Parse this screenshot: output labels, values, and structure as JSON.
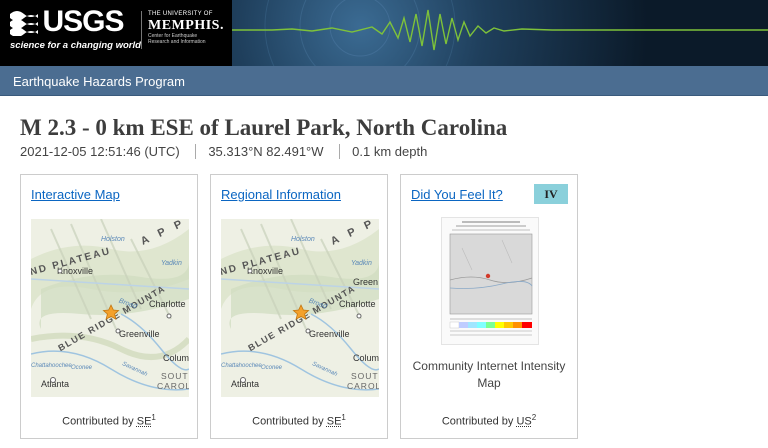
{
  "header": {
    "agency": "USGS",
    "tagline": "science for a changing world",
    "partner_small": "THE UNIVERSITY OF",
    "partner_name": "MEMPHIS.",
    "partner_sub": "Center for Earthquake Research and Information"
  },
  "program": {
    "label": "Earthquake Hazards Program"
  },
  "event": {
    "title": "M 2.3 - 0 km ESE of Laurel Park, North Carolina",
    "time": "2021-12-05 12:51:46 (UTC)",
    "location": "35.313°N 82.491°W",
    "depth": "0.1 km depth"
  },
  "cards": [
    {
      "link": "Interactive Map",
      "contributed_prefix": "Contributed by",
      "source": "SE",
      "ref": "1",
      "map_labels": {
        "plateau": "ND PLATEAU",
        "appa": "A P P",
        "blue_ridge": "BLUE RIDGE MOUNTA",
        "knoxville": "Knoxville",
        "charlotte": "Charlotte",
        "greenville": "Greenville",
        "atlanta": "Atlanta",
        "colum": "Colum",
        "south": "SOUT",
        "caroli": "CAROLI",
        "broad": "Broad",
        "holston": "Holston",
        "yadkin": "Yadkin",
        "chattahoochee": "Chattahoochee",
        "oconee": "Oconee",
        "savannah": "Savannah"
      }
    },
    {
      "link": "Regional Information",
      "contributed_prefix": "Contributed by",
      "source": "SE",
      "ref": "1",
      "map_labels": {
        "plateau": "ND PLATEAU",
        "appa": "A P P",
        "blue_ridge": "BLUE RIDGE MOUNTA",
        "knoxville": "Knoxville",
        "charlotte": "Charlotte",
        "greenville": "Greenville",
        "green": "Green",
        "atlanta": "Atlanta",
        "colum": "Colum",
        "south": "SOUT",
        "caroli": "CAROLI",
        "broad": "Broad",
        "holston": "Holston",
        "yadkin": "Yadkin",
        "chattahoochee": "Chattahoochee",
        "oconee": "Oconee",
        "savannah": "Savannah"
      }
    },
    {
      "link": "Did You Feel It?",
      "intensity": "IV",
      "caption": "Community Internet Intensity Map",
      "contributed_prefix": "Contributed by",
      "source": "US",
      "ref": "2"
    }
  ],
  "colors": {
    "program_bar": "#4b6d91",
    "link": "#0b66c2",
    "intensity_badge": "#8ad0db",
    "epicenter": "#f4a12b"
  }
}
